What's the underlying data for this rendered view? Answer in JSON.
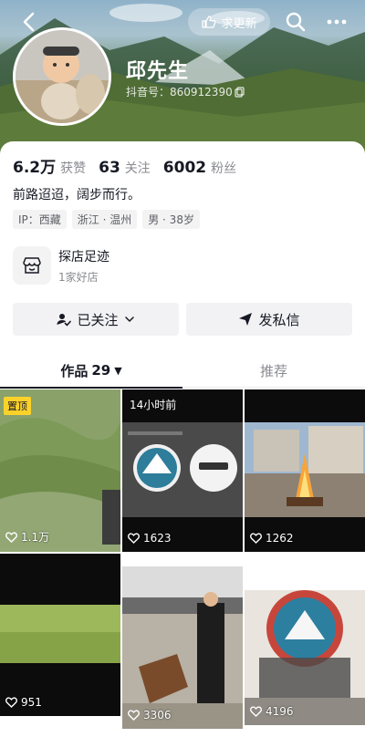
{
  "header": {
    "update_label": "求更新",
    "name": "邱先生",
    "douyin_id": "抖音号：860912390"
  },
  "stats": [
    {
      "value": "6.2万",
      "label": "获赞"
    },
    {
      "value": "63",
      "label": "关注"
    },
    {
      "value": "6002",
      "label": "粉丝"
    }
  ],
  "bio": "前路迢迢，阔步而行。",
  "tags": [
    "IP：西藏",
    "浙江 · 温州",
    "男 · 38岁"
  ],
  "shop": {
    "title": "探店足迹",
    "subtitle": "1家好店"
  },
  "actions": {
    "follow_label": "已关注",
    "message_label": "发私信"
  },
  "tabs": {
    "works_label": "作品",
    "works_count": "29",
    "recommend_label": "推荐"
  },
  "videos": [
    {
      "count": "1.1万",
      "badge": "置顶"
    },
    {
      "count": "1623",
      "badge": "14小时前"
    },
    {
      "count": "1262",
      "badge": ""
    },
    {
      "count": "951",
      "badge": ""
    },
    {
      "count": "3306",
      "badge": ""
    },
    {
      "count": "4196",
      "badge": ""
    }
  ],
  "colors": {
    "text": "#161823",
    "secondary": "#8a8b91",
    "badge_top": "#fcd22a"
  }
}
